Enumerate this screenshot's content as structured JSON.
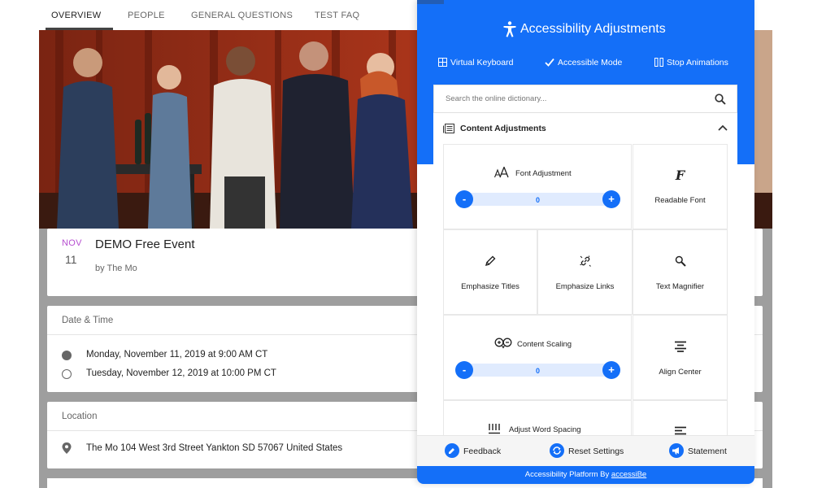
{
  "nav": {
    "tabs": [
      {
        "label": "OVERVIEW"
      },
      {
        "label": "PEOPLE"
      },
      {
        "label": "GENERAL QUESTIONS"
      },
      {
        "label": "TEST FAQ"
      }
    ],
    "active_tab": "OVERVIEW"
  },
  "event": {
    "month": "NOV",
    "day": "11",
    "title": "DEMO Free Event",
    "by": "by The Mo"
  },
  "datetime": {
    "heading": "Date & Time",
    "rows": [
      {
        "text": "Monday, November 11, 2019 at 9:00 AM CT"
      },
      {
        "text": "Tuesday, November 12, 2019 at 10:00 PM CT"
      }
    ]
  },
  "location": {
    "heading": "Location",
    "address": "The Mo 104 West 3rd Street Yankton SD 57067 United States"
  },
  "accessibility": {
    "title": "Accessibility Adjustments",
    "tools": [
      {
        "label": "Virtual Keyboard"
      },
      {
        "label": "Accessible Mode"
      },
      {
        "label": "Stop Animations"
      }
    ],
    "search": {
      "placeholder": "Search the online dictionary..."
    },
    "section_title": "Content Adjustments",
    "font_adjustment": {
      "label": "Font Adjustment",
      "value": "0",
      "minus": "-",
      "plus": "+"
    },
    "readable_font": {
      "label": "Readable Font",
      "glyph": "F"
    },
    "emphasize_titles": {
      "label": "Emphasize Titles"
    },
    "emphasize_links": {
      "label": "Emphasize Links"
    },
    "text_magnifier": {
      "label": "Text Magnifier"
    },
    "content_scaling": {
      "label": "Content Scaling",
      "value": "0",
      "minus": "-",
      "plus": "+"
    },
    "align_center": {
      "label": "Align Center"
    },
    "adjust_word_spacing": {
      "label": "Adjust Word Spacing"
    },
    "footer": {
      "feedback": "Feedback",
      "reset": "Reset Settings",
      "statement": "Statement"
    },
    "platform_prefix": "Accessibility Platform By ",
    "platform_brand": "accessiBe"
  },
  "colors": {
    "accent": "#146ff8",
    "month": "#b64fd0",
    "background_gray": "#9e9e9e"
  }
}
